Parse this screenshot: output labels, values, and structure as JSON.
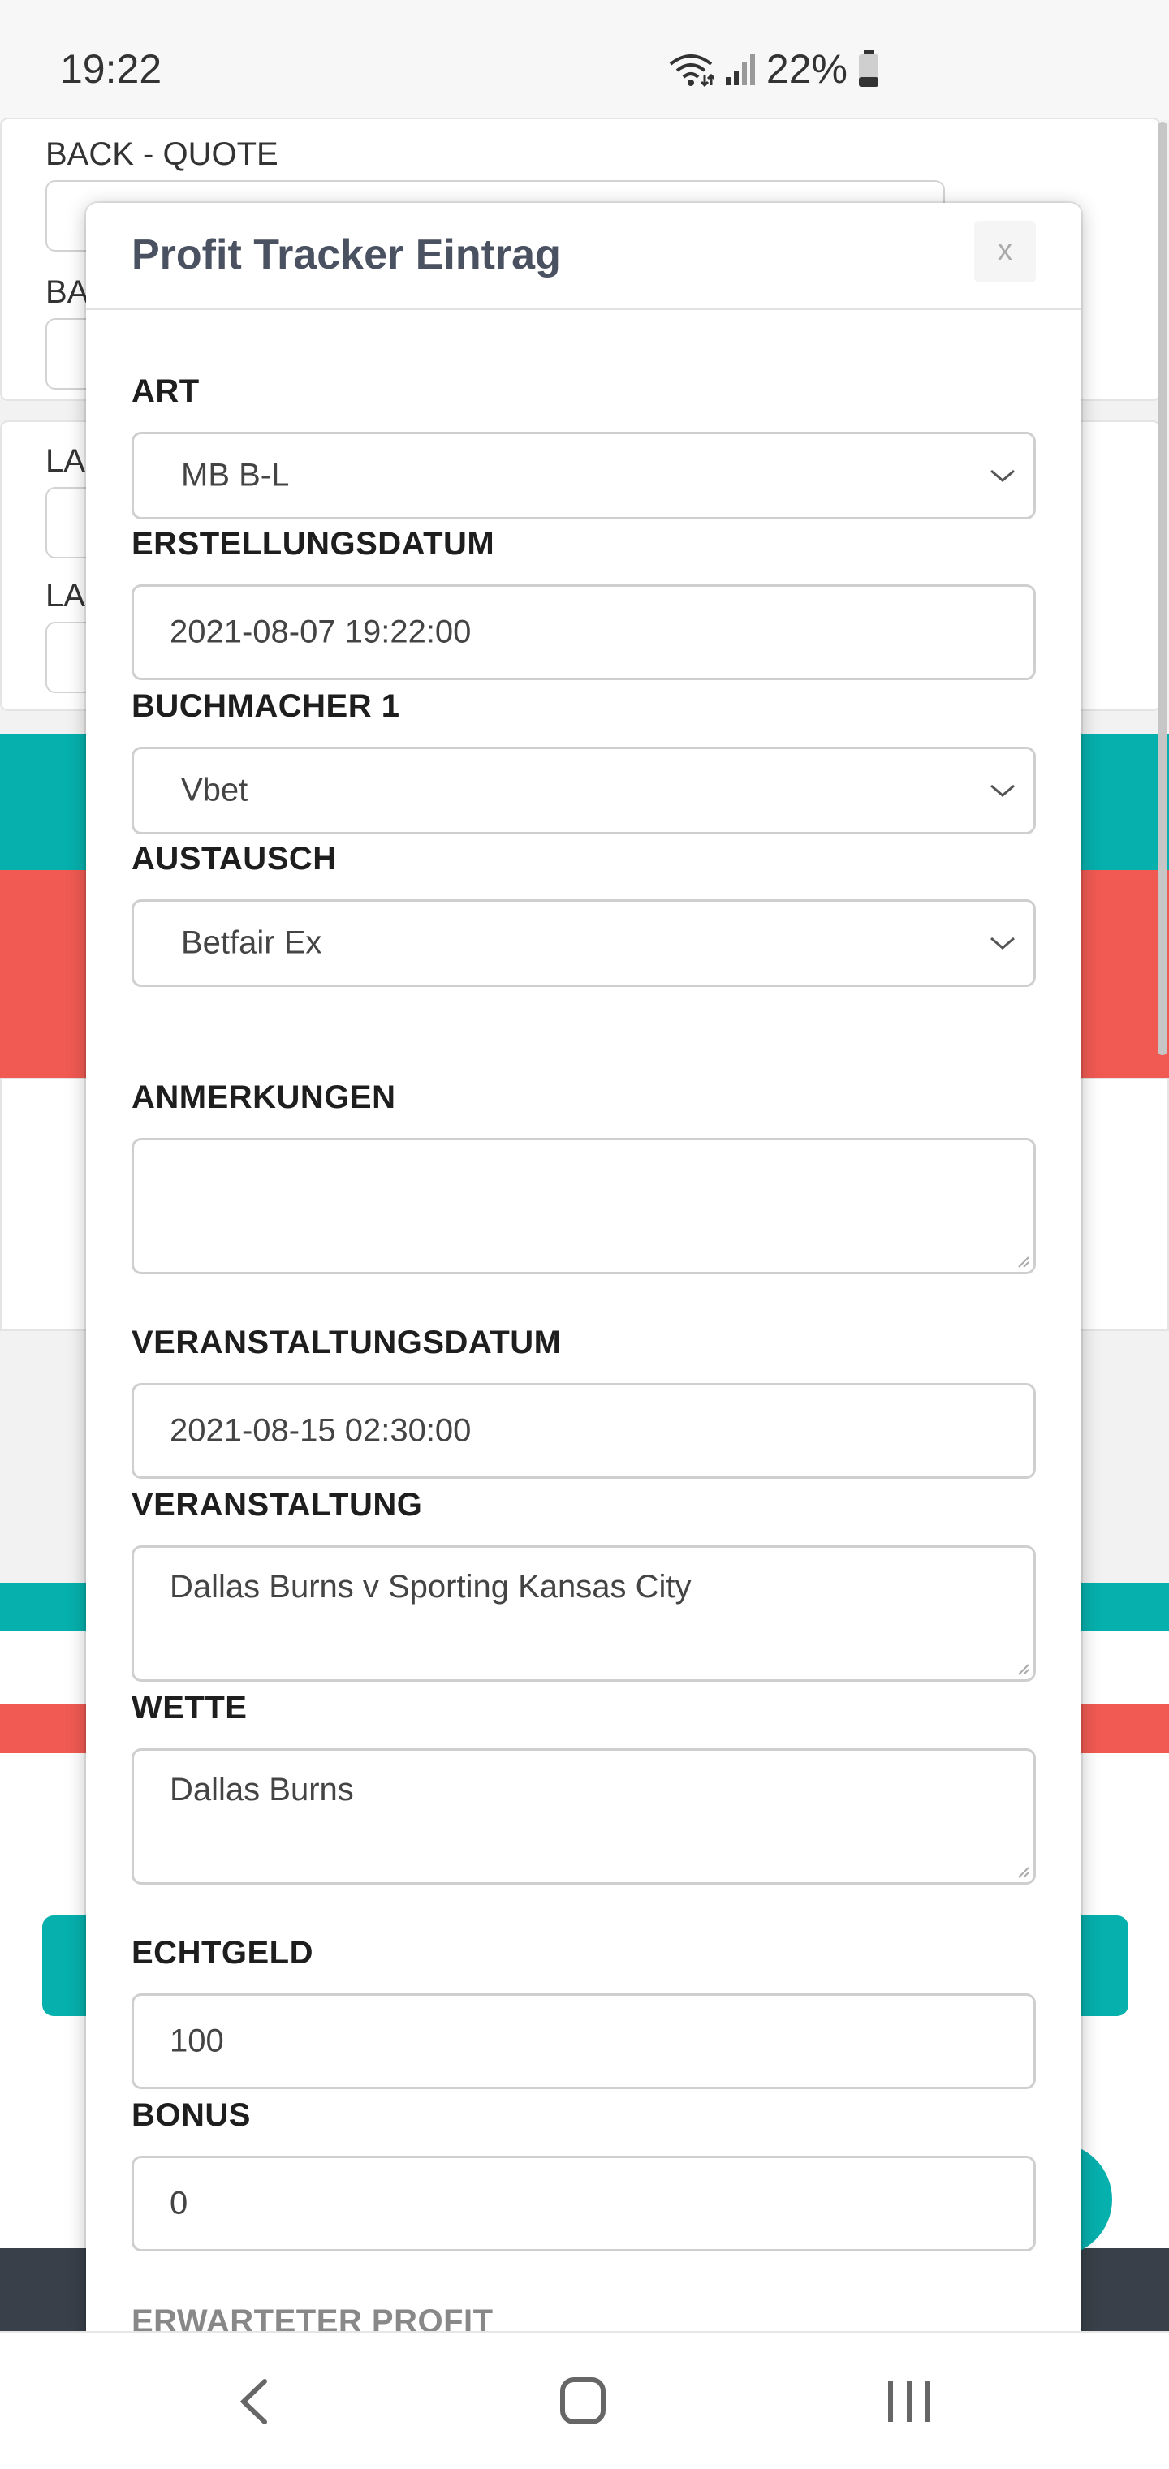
{
  "status_bar": {
    "time": "19:22",
    "battery_percent": "22%",
    "icons": [
      "wifi-icon",
      "signal-icon",
      "battery-icon"
    ]
  },
  "background": {
    "back_quote_label": "BACK - QUOTE",
    "partial_label_ba": "BA",
    "partial_label_la_1": "LA",
    "partial_label_la_2": "LA"
  },
  "modal": {
    "title": "Profit Tracker Eintrag",
    "close_label": "x",
    "fields": {
      "art": {
        "label": "ART",
        "value": "MB B-L"
      },
      "erstellungsdatum": {
        "label": "ERSTELLUNGSDATUM",
        "value": "2021-08-07 19:22:00"
      },
      "buchmacher1": {
        "label": "BUCHMACHER 1",
        "value": "Vbet"
      },
      "austausch": {
        "label": "AUSTAUSCH",
        "value": "Betfair Ex"
      },
      "anmerkungen": {
        "label": "ANMERKUNGEN",
        "value": ""
      },
      "veranstaltungsdatum": {
        "label": "VERANSTALTUNGSDATUM",
        "value": "2021-08-15 02:30:00"
      },
      "veranstaltung": {
        "label": "VERANSTALTUNG",
        "value": "Dallas Burns v Sporting Kansas City"
      },
      "wette": {
        "label": "WETTE",
        "value": "Dallas Burns"
      },
      "echtgeld": {
        "label": "ECHTGELD",
        "value": "100"
      },
      "bonus": {
        "label": "BONUS",
        "value": "0"
      },
      "erwarteter_profit": {
        "label": "ERWARTETER PROFIT"
      }
    }
  },
  "nav": {
    "icons": [
      "back-icon",
      "home-icon",
      "recents-icon"
    ]
  },
  "colors": {
    "teal": "#06b0ad",
    "coral": "#f05a52",
    "dark": "#394049",
    "title": "#4a5160"
  }
}
